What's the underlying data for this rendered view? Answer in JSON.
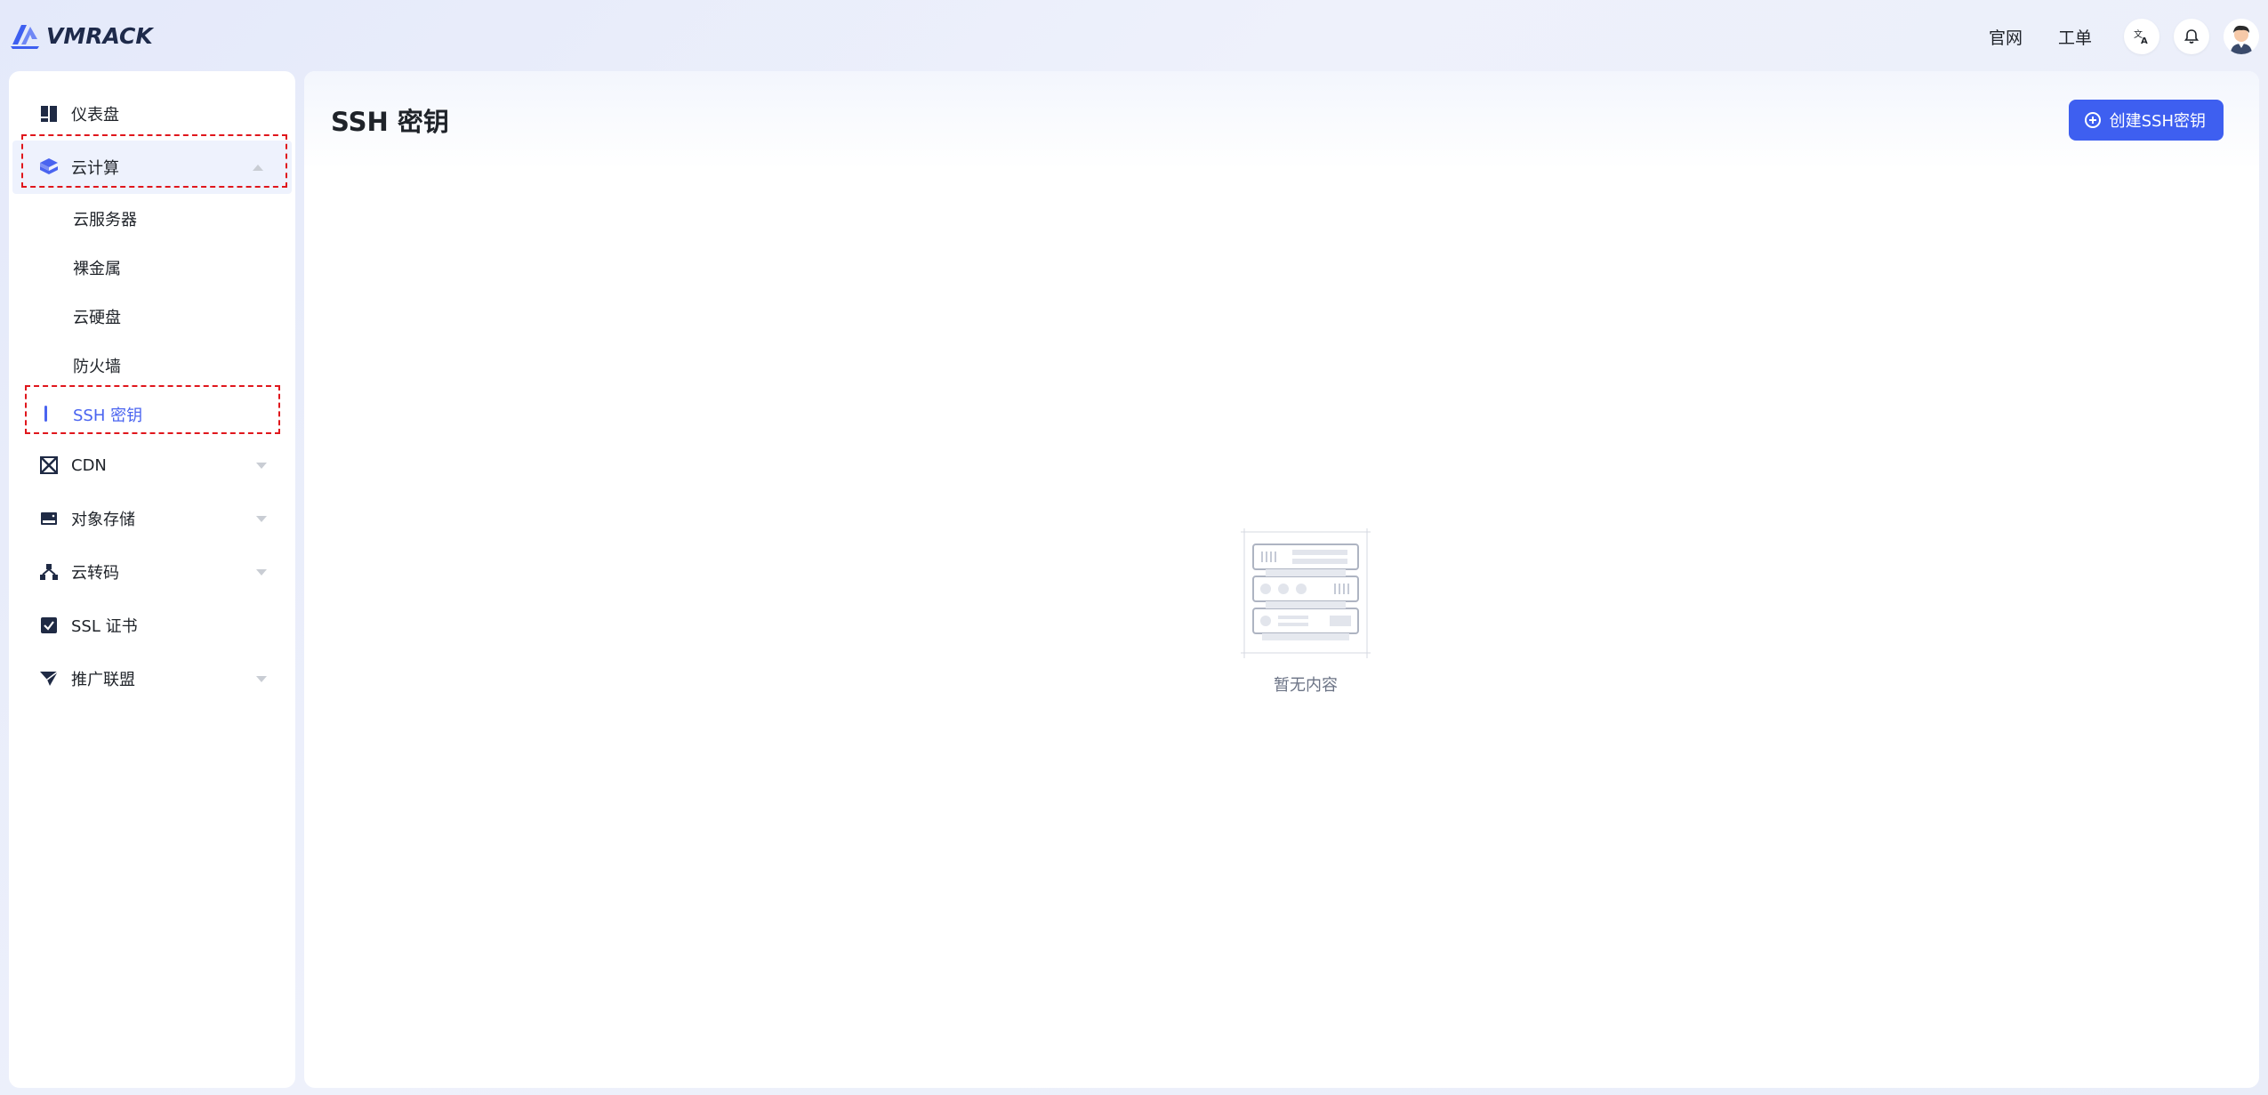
{
  "header": {
    "logo_text": "VMRACK",
    "links": [
      "官网",
      "工单"
    ],
    "brand_color": "#3e5ff0"
  },
  "sidebar": {
    "items": [
      {
        "label": "仪表盘",
        "icon": "dashboard-icon"
      },
      {
        "label": "云计算",
        "icon": "cube-stack-icon",
        "expanded": true
      },
      {
        "label": "CDN",
        "icon": "cdn-icon"
      },
      {
        "label": "对象存储",
        "icon": "storage-icon"
      },
      {
        "label": "云转码",
        "icon": "transcode-icon"
      },
      {
        "label": "SSL 证书",
        "icon": "certificate-icon"
      },
      {
        "label": "推广联盟",
        "icon": "paper-plane-icon"
      }
    ],
    "sub_items": [
      "云服务器",
      "裸金属",
      "云硬盘",
      "防火墙",
      "SSH 密钥"
    ],
    "active_sub": "SSH 密钥"
  },
  "main": {
    "title": "SSH 密钥",
    "create_button": "创建SSH密钥",
    "empty_text": "暂无内容"
  }
}
